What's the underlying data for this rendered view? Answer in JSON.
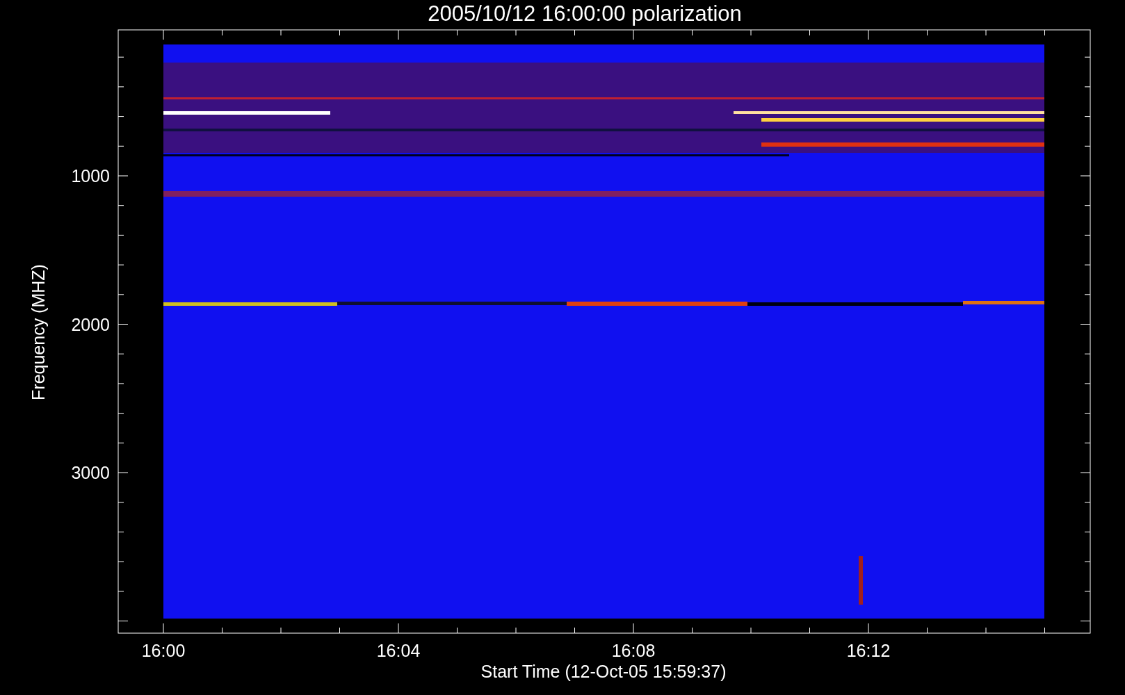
{
  "title": "2005/10/12 16:00:00 polarization",
  "x_axis": {
    "label": "Start Time (12-Oct-05 15:59:37)",
    "ticks": [
      "16:00",
      "16:04",
      "16:08",
      "16:12"
    ]
  },
  "y_axis": {
    "label": "Frequency (MHZ)",
    "ticks": [
      "1000",
      "2000",
      "3000"
    ]
  }
}
